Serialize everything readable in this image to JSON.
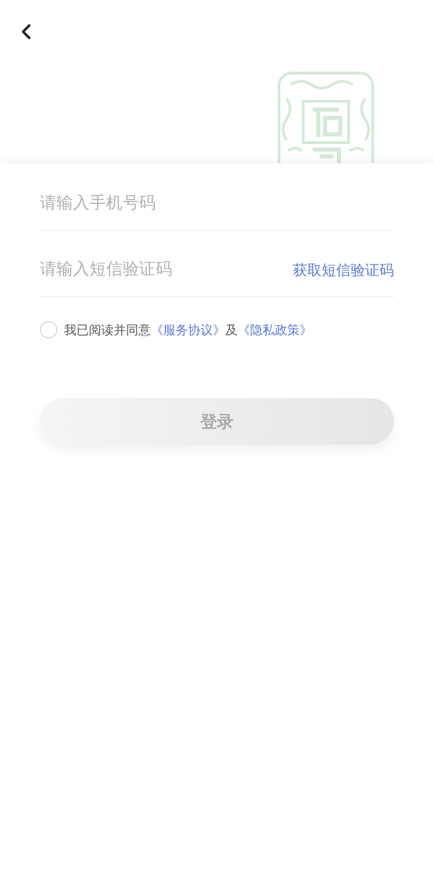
{
  "phone_field": {
    "placeholder": "请输入手机号码"
  },
  "code_field": {
    "placeholder": "请输入短信验证码",
    "action": "获取短信验证码"
  },
  "agreement": {
    "checked": false,
    "parts": [
      {
        "kind": "text",
        "text": "我已阅读并同意"
      },
      {
        "kind": "link",
        "text": "《服务协议》"
      },
      {
        "kind": "text",
        "text": "及"
      },
      {
        "kind": "link",
        "text": "《隐私政策》"
      }
    ]
  },
  "login_button": {
    "label": "登录",
    "disabled": true
  }
}
